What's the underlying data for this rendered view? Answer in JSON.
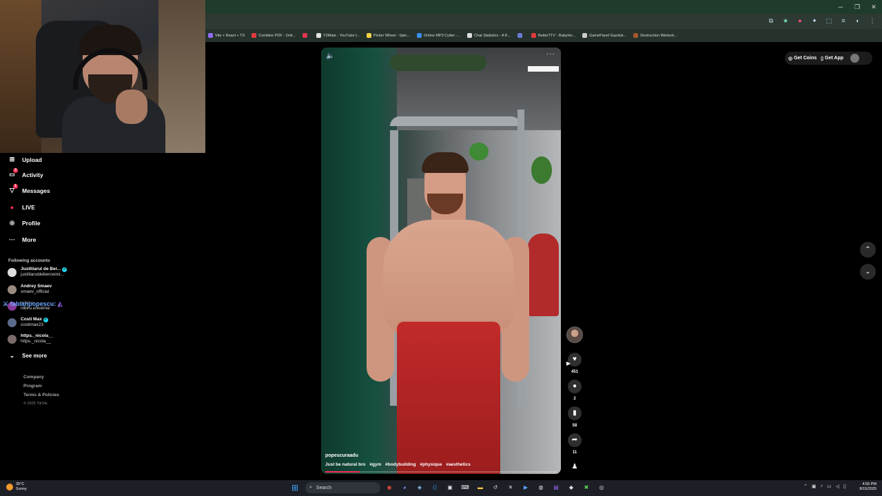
{
  "window_controls": {
    "minimize": "─",
    "restore": "❐",
    "close": "✕"
  },
  "bookmarks": [
    {
      "label": "Vite + React + TS",
      "color": "#8f6cf5"
    },
    {
      "label": "Combine PDF - Onli...",
      "color": "#e33b3b"
    },
    {
      "label": "",
      "color": "#e3364f"
    },
    {
      "label": "Y2Mate - YouTube t...",
      "color": "#e3e3e3"
    },
    {
      "label": "Picker Wheel - Spin...",
      "color": "#f3d24a"
    },
    {
      "label": "Online MP3 Cutter -...",
      "color": "#3a8ef0"
    },
    {
      "label": "Chat Statistics - A K...",
      "color": "#dddddd"
    },
    {
      "label": "",
      "color": "#6a7bd6"
    },
    {
      "label": "BetterTTV - BabyHo...",
      "color": "#e33b3b"
    },
    {
      "label": "GamePanel Gazduir...",
      "color": "#cccccc"
    },
    {
      "label": "Destruction Warlock...",
      "color": "#a4582a"
    }
  ],
  "sidebar": {
    "nav": [
      {
        "label": "Upload",
        "icon": "⊞"
      },
      {
        "label": "Activity",
        "icon": "▭",
        "badge": "3"
      },
      {
        "label": "Messages",
        "icon": "▽",
        "badge": "1"
      },
      {
        "label": "LIVE",
        "icon": "●"
      },
      {
        "label": "Profile",
        "icon": "◉"
      },
      {
        "label": "More",
        "icon": "···"
      }
    ],
    "following_label": "Following accounts",
    "accounts": [
      {
        "name": "Justitiarul de Ber...",
        "handle": "justitiaruldeberceinir...",
        "verified": true
      },
      {
        "name": "Andrey Smaev",
        "handle": "smaev_official",
        "verified": false
      },
      {
        "name": "nibiru",
        "handle": "nibiru.universe",
        "verified": false
      },
      {
        "name": "Costi Max",
        "handle": "costimax23",
        "verified": true
      },
      {
        "name": "https._nicola__",
        "handle": "https._nicola__",
        "verified": false
      }
    ],
    "see_more": "See more",
    "chat_overlay": "fabianpopescu:",
    "footer": [
      "Company",
      "Program",
      "Terms & Policies"
    ],
    "copyright": "© 2025 TikTok"
  },
  "video": {
    "username": "popescuraadu",
    "caption": "Just be natural bro",
    "hashtags": [
      "#gym",
      "#bodybuilding",
      "#physique",
      "#aesthetics"
    ],
    "progress": 0.15
  },
  "actions": {
    "likes": "451",
    "comments": "2",
    "saves": "58",
    "shares": "11"
  },
  "topbar": {
    "get_coins": "Get Coins",
    "get_app": "Get App"
  },
  "taskbar": {
    "temperature": "35°C",
    "weather": "Sunny",
    "search": "Search",
    "time": "4:55 PM",
    "date": "8/15/2025"
  }
}
